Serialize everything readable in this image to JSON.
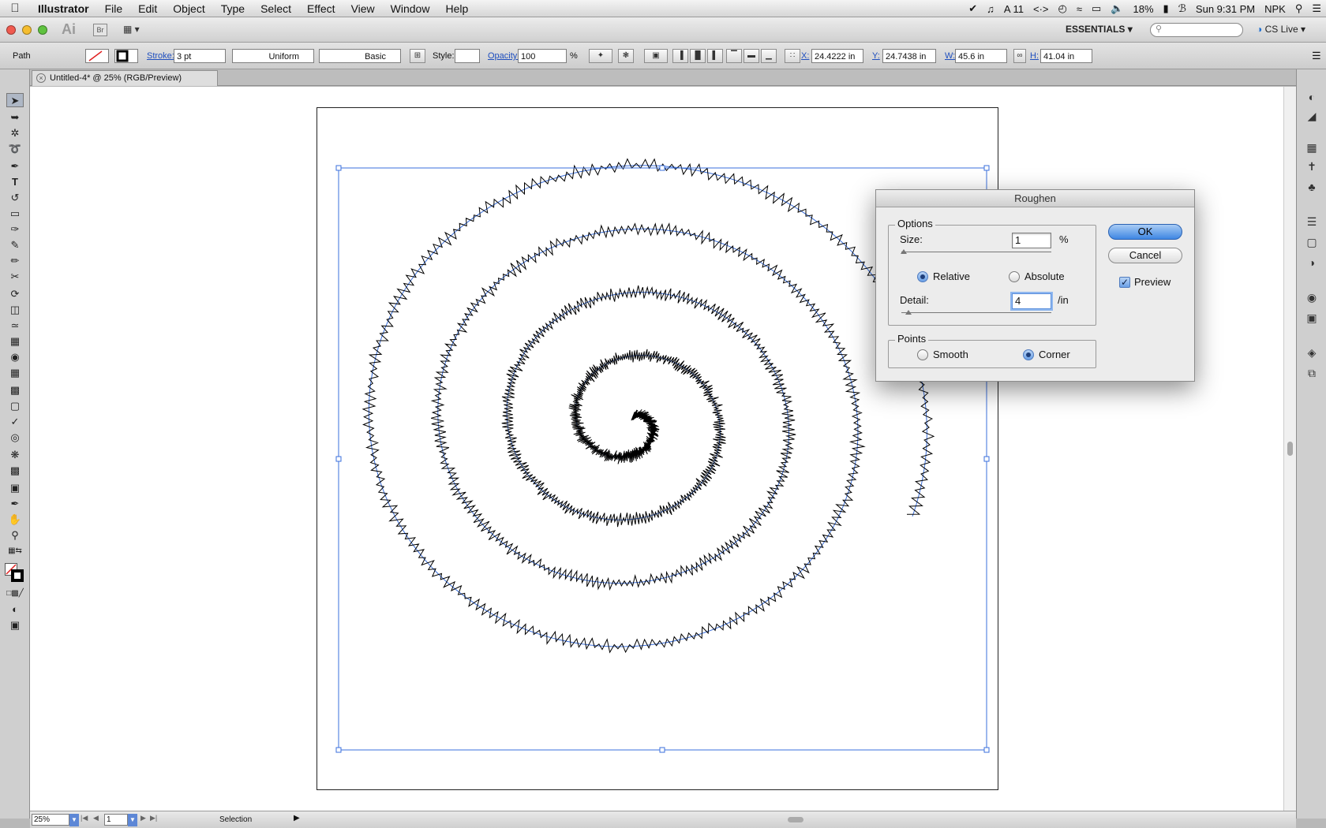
{
  "menubar": {
    "app_name": "Illustrator",
    "items": [
      "File",
      "Edit",
      "Object",
      "Type",
      "Select",
      "Effect",
      "View",
      "Window",
      "Help"
    ],
    "status": {
      "adobe_count": "11",
      "battery": "18%",
      "clock": "Sun 9:31 PM",
      "user": "NPK"
    }
  },
  "appbar": {
    "logo": "Ai",
    "bridge": "Br",
    "workspace": "ESSENTIALS",
    "cslive": "CS Live"
  },
  "controlbar": {
    "selection_type": "Path",
    "stroke_label": "Stroke:",
    "stroke_weight": "3 pt",
    "profile": "Uniform",
    "brush": "Basic",
    "style_label": "Style:",
    "opacity_label": "Opacity:",
    "opacity_value": "100",
    "percent": "%",
    "x_label": "X:",
    "x_value": "24.4222 in",
    "y_label": "Y:",
    "y_value": "24.7438 in",
    "w_label": "W:",
    "w_value": "45.6 in",
    "h_label": "H:",
    "h_value": "41.04 in"
  },
  "document": {
    "tab_title": "Untitled-4* @ 25% (RGB/Preview)"
  },
  "statusbar": {
    "zoom": "25%",
    "page": "1",
    "tool": "Selection"
  },
  "dialog": {
    "title": "Roughen",
    "options_label": "Options",
    "size_label": "Size:",
    "size_value": "1",
    "size_unit": "%",
    "relative_label": "Relative",
    "absolute_label": "Absolute",
    "relative_selected": true,
    "detail_label": "Detail:",
    "detail_value": "4",
    "detail_unit": "/in",
    "points_label": "Points",
    "smooth_label": "Smooth",
    "corner_label": "Corner",
    "corner_selected": true,
    "ok_label": "OK",
    "cancel_label": "Cancel",
    "preview_label": "Preview",
    "preview_checked": true
  },
  "colors": {
    "selection_blue": "#3a6fdc",
    "path_stroke": "#000000"
  }
}
